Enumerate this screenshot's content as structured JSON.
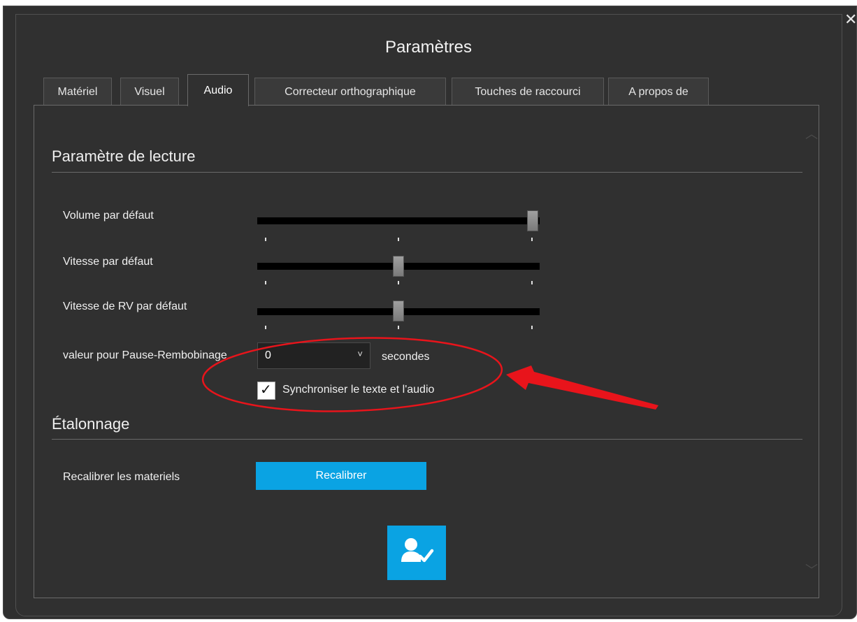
{
  "dialog": {
    "title": "Paramètres",
    "close_symbol": "✕",
    "icons": {
      "close": "close-icon",
      "save": "user-check-icon",
      "scroll_up": "chevron-up-icon",
      "scroll_down": "chevron-down-icon",
      "dropdown": "chevron-down-icon",
      "check": "check-icon"
    }
  },
  "tabs": [
    {
      "label": "Matériel",
      "active": false
    },
    {
      "label": "Visuel",
      "active": false
    },
    {
      "label": "Audio",
      "active": true
    },
    {
      "label": "Correcteur orthographique",
      "active": false
    },
    {
      "label": "Touches de raccourci",
      "active": false
    },
    {
      "label": "A propos de",
      "active": false
    }
  ],
  "playback": {
    "heading": "Paramètre de lecture",
    "volume": {
      "label": "Volume par défaut",
      "value_fraction": 1.0
    },
    "speed": {
      "label": "Vitesse par défaut",
      "value_fraction": 0.5
    },
    "rv_speed": {
      "label": "Vitesse de RV par défaut",
      "value_fraction": 0.5
    },
    "pause_rewind": {
      "label": "valeur pour Pause-Rembobinage",
      "value": "0",
      "unit": "secondes"
    },
    "sync": {
      "label": "Synchroniser le texte et l'audio",
      "checked": true
    }
  },
  "calibration": {
    "heading": "Étalonnage",
    "recalibrate_label": "Recalibrer les materiels",
    "recalibrate_button": "Recalibrer"
  },
  "colors": {
    "accent": "#0aa3e3",
    "background": "#303030",
    "annotation": "#e8141b"
  }
}
